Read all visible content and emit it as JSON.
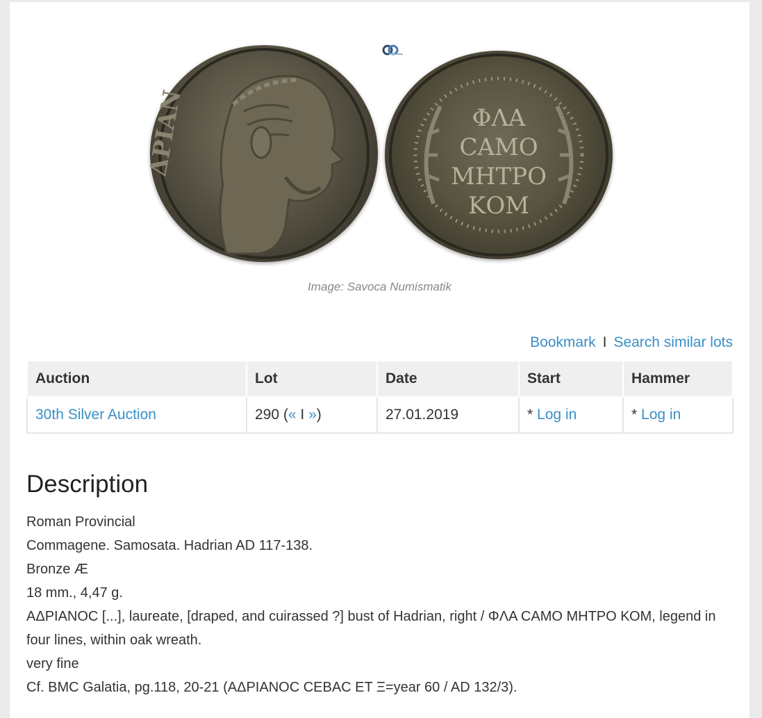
{
  "image": {
    "caption": "Image: Savoca Numismatik",
    "obverse_legend": "ΔΡΙΑΝ",
    "reverse_legend": [
      "ΦΛΑ",
      "CAMO",
      "ΜΗΤΡΟ",
      "ΚΟΜ"
    ]
  },
  "actions": {
    "bookmark": "Bookmark",
    "separator": "I",
    "search_similar": "Search similar lots"
  },
  "table": {
    "headers": [
      "Auction",
      "Lot",
      "Date",
      "Start",
      "Hammer"
    ],
    "row": {
      "auction": "30th Silver Auction",
      "lot_number": "290",
      "lot_prev": "«",
      "lot_sep": "I",
      "lot_next": "»",
      "date": "27.01.2019",
      "start_prefix": "*",
      "start_link": "Log in",
      "hammer_prefix": "*",
      "hammer_link": "Log in"
    }
  },
  "description": {
    "title": "Description",
    "lines": [
      "Roman Provincial",
      "Commagene. Samosata. Hadrian AD 117-138.",
      "Bronze Æ",
      "18 mm., 4,47 g.",
      "ΑΔΡΙΑΝΟC [...], laureate, [draped, and cuirassed ?] bust of Hadrian, right / ΦΛΑ CAMO ΜΗΤΡΟ ΚΟΜ, legend in four lines, within oak wreath.",
      "very fine",
      "Cf. BMC Galatia, pg.118, 20-21 (ΑΔΡΙΑΝΟC CEBAC ET Ξ=year 60 / AD 132/3)."
    ]
  },
  "colors": {
    "link": "#3a8fc7",
    "header_bg": "#efefef",
    "page_bg": "#ebebeb"
  }
}
